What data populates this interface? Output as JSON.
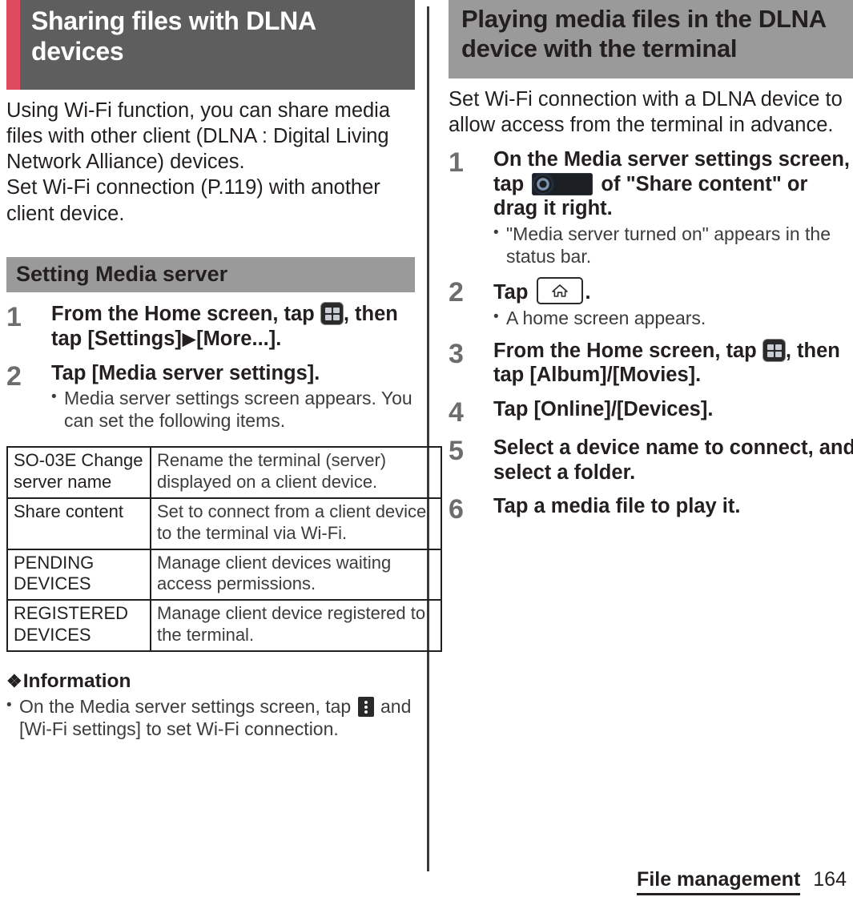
{
  "colors": {
    "accent_red": "#e04a5f",
    "heading_dark_gray": "#5e5e5e",
    "band_gray": "#9a9a9a",
    "text": "#231f20",
    "step_number_gray": "#6d6d6d"
  },
  "left_column": {
    "chapter_heading": "Sharing files with DLNA devices",
    "intro_paragraphs": [
      "Using Wi-Fi function, you can share media files with other client (DLNA : Digital Living Network Alliance) devices.",
      "Set Wi-Fi connection (P.119) with another client device."
    ],
    "section_band": "Setting Media server",
    "steps": [
      {
        "number": "1",
        "title_before_icon": "From the Home screen, tap ",
        "icon": "app-grid-icon",
        "title_after_icon": ", then tap [Settings]",
        "arrow": "▶",
        "title_tail": "[More...].",
        "notes": []
      },
      {
        "number": "2",
        "title_before_icon": "Tap [Media server settings].",
        "icon": null,
        "title_after_icon": "",
        "arrow": "",
        "title_tail": "",
        "notes": [
          "Media server settings screen appears. You can set the following items."
        ]
      }
    ],
    "table": {
      "rows": [
        {
          "item": "SO-03E Change server name",
          "description": "Rename the terminal (server) displayed on a client device."
        },
        {
          "item": "Share content",
          "description": "Set to connect from a client device to the terminal via Wi-Fi."
        },
        {
          "item": "PENDING DEVICES",
          "description": "Manage client devices waiting access permissions."
        },
        {
          "item": "REGISTERED DEVICES",
          "description": "Manage client device registered to the terminal."
        }
      ]
    },
    "information": {
      "diamond": "❖",
      "heading": "Information",
      "items": [
        {
          "text_before_icon": "On the Media server settings screen, tap ",
          "icon": "kebab-menu-icon",
          "text_after_icon": " and [Wi-Fi settings] to set Wi-Fi connection."
        }
      ]
    }
  },
  "right_column": {
    "chapter_heading": "Playing media files in the DLNA device with the terminal",
    "intro_paragraphs": [
      "Set Wi-Fi connection with a DLNA device to allow access from the terminal in advance."
    ],
    "steps": [
      {
        "number": "1",
        "title_before_icon": "On the Media server settings screen, tap ",
        "icon": "toggle-switch-icon",
        "title_after_icon": " of \"Share content\" or drag it right.",
        "notes": [
          "\"Media server turned on\" appears in the status bar."
        ]
      },
      {
        "number": "2",
        "title_before_icon": "Tap ",
        "icon": "home-key-icon",
        "title_after_icon": ".",
        "notes": [
          "A home screen appears."
        ]
      },
      {
        "number": "3",
        "title_before_icon": "From the Home screen, tap ",
        "icon": "app-grid-icon",
        "title_after_icon": ", then tap [Album]/[Movies].",
        "notes": []
      },
      {
        "number": "4",
        "title_before_icon": "Tap [Online]/[Devices].",
        "icon": null,
        "title_after_icon": "",
        "notes": []
      },
      {
        "number": "5",
        "title_before_icon": "Select a device name to connect, and select a folder.",
        "icon": null,
        "title_after_icon": "",
        "notes": []
      },
      {
        "number": "6",
        "title_before_icon": "Tap a media file to play it.",
        "icon": null,
        "title_after_icon": "",
        "notes": []
      }
    ]
  },
  "footer": {
    "chapter_name": "File management",
    "page_number": "164"
  },
  "bullet": "•"
}
